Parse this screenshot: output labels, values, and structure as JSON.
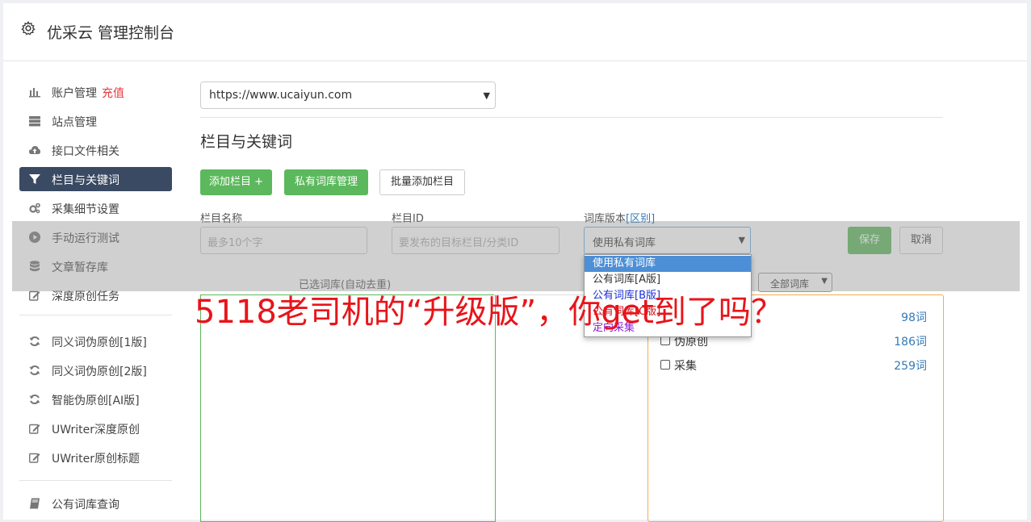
{
  "header": {
    "title": "优采云 管理控制台"
  },
  "sidebar": {
    "items": [
      {
        "label": "账户管理",
        "badge": "充值",
        "icon": "bar-chart-icon"
      },
      {
        "label": "站点管理",
        "icon": "server-icon"
      },
      {
        "label": "接口文件相关",
        "icon": "cloud-upload-icon"
      },
      {
        "label": "栏目与关键词",
        "icon": "filter-icon",
        "active": true
      },
      {
        "label": "采集细节设置",
        "icon": "cogs-icon"
      },
      {
        "label": "手动运行测试",
        "icon": "play-icon"
      },
      {
        "label": "文章暂存库",
        "icon": "database-icon"
      },
      {
        "label": "深度原创任务",
        "icon": "edit-icon"
      },
      {
        "label": "同义词伪原创[1版]",
        "icon": "refresh-icon"
      },
      {
        "label": "同义词伪原创[2版]",
        "icon": "refresh-icon"
      },
      {
        "label": "智能伪原创[AI版]",
        "icon": "refresh-icon"
      },
      {
        "label": "UWriter深度原创",
        "icon": "edit-icon"
      },
      {
        "label": "UWriter原创标题",
        "icon": "edit-icon"
      },
      {
        "label": "公有词库查询",
        "icon": "book-icon"
      }
    ]
  },
  "main": {
    "site_select": "https://www.ucaiyun.com",
    "section_title": "栏目与关键词",
    "buttons": {
      "add_column": "添加栏目 +",
      "private_lib": "私有词库管理",
      "batch_add": "批量添加栏目"
    },
    "form": {
      "name_label": "栏目名称",
      "name_placeholder": "最多10个字",
      "id_label": "栏目ID",
      "id_placeholder": "要发布的目标栏目/分类ID",
      "version_label": "词库版本",
      "version_link": "[区别]",
      "version_value": "使用私有词库",
      "save": "保存",
      "cancel": "取消"
    },
    "selected_label": "已选词库(自动去重)",
    "filter_value": "全部词库",
    "libraries": [
      {
        "name": "",
        "count": "98词"
      },
      {
        "name": "伪原创",
        "count": "186词"
      },
      {
        "name": "采集",
        "count": "259词"
      }
    ],
    "dropdown_options": [
      {
        "label": "使用私有词库",
        "color": "#ffffff",
        "selected": true
      },
      {
        "label": "公有词库[A版]",
        "color": "#333333"
      },
      {
        "label": "公有词库[B版]",
        "color": "#1a2fd6"
      },
      {
        "label": "公有词库[C版]",
        "color": "#d0121b"
      },
      {
        "label": "定向采集",
        "color": "#8a1bd6"
      }
    ]
  },
  "overlay_caption": "5118老司机的“升级版”，你get到了吗？"
}
